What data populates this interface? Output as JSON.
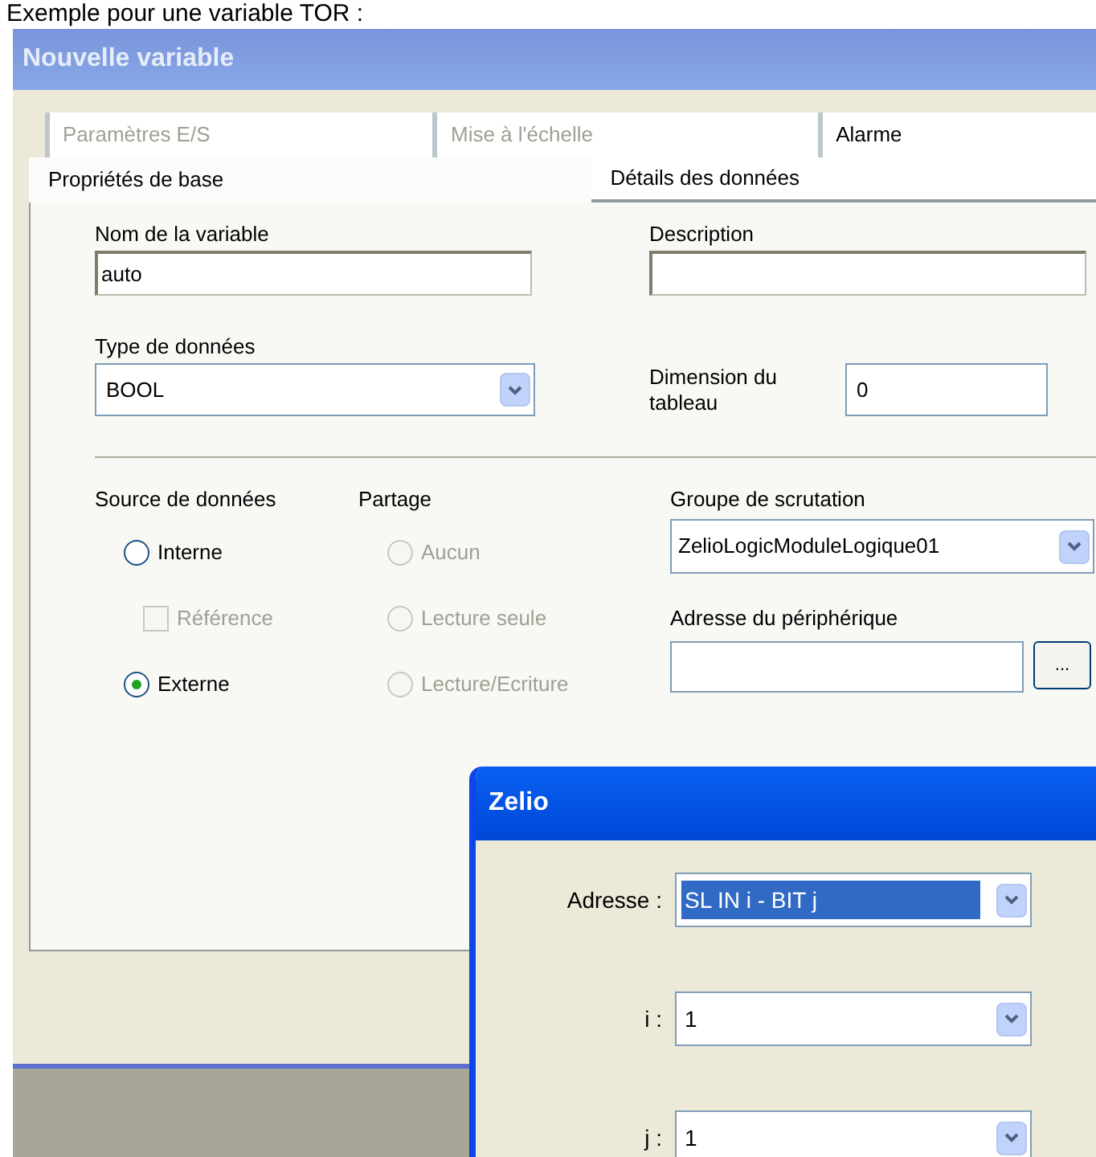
{
  "caption": "Exemple pour une variable TOR :",
  "window": {
    "title": "Nouvelle variable"
  },
  "tabs_back": [
    {
      "label": "Paramètres E/S",
      "disabled": true
    },
    {
      "label": "Mise à l'échelle",
      "disabled": true
    },
    {
      "label": "Alarme",
      "disabled": false
    }
  ],
  "tabs_front": [
    {
      "label": "Propriétés de base",
      "selected": true
    },
    {
      "label": "Détails des données",
      "selected": false
    }
  ],
  "fields": {
    "name": {
      "label": "Nom de la variable",
      "value": "auto"
    },
    "description": {
      "label": "Description"
    },
    "data_type": {
      "label": "Type de données",
      "value": "BOOL"
    },
    "dimension": {
      "label": "Dimension du tableau",
      "value": "0"
    }
  },
  "source": {
    "label": "Source de données",
    "options": [
      {
        "label": "Interne",
        "kind": "radio",
        "selected": false,
        "disabled": false
      },
      {
        "label": "Référence",
        "kind": "checkbox",
        "checked": false,
        "disabled": true
      },
      {
        "label": "Externe",
        "kind": "radio",
        "selected": true,
        "disabled": false
      }
    ]
  },
  "sharing": {
    "label": "Partage",
    "options": [
      {
        "label": "Aucun",
        "selected": false,
        "disabled": true
      },
      {
        "label": "Lecture seule",
        "selected": false,
        "disabled": true
      },
      {
        "label": "Lecture/Ecriture",
        "selected": false,
        "disabled": true
      }
    ]
  },
  "scan_group": {
    "label": "Groupe de scrutation",
    "value": "ZelioLogicModuleLogique01"
  },
  "device_address": {
    "label": "Adresse du périphérique",
    "browse": "..."
  },
  "zelio": {
    "title": "Zelio",
    "rows": [
      {
        "label": "Adresse :",
        "value": "SL IN i - BIT j",
        "highlighted": true
      },
      {
        "label": "i :",
        "value": "1",
        "highlighted": false
      },
      {
        "label": "j :",
        "value": "1",
        "highlighted": false
      }
    ]
  }
}
